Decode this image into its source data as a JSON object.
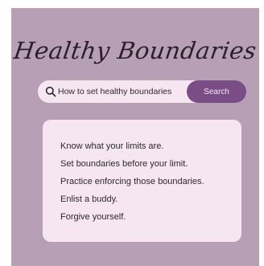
{
  "title": "Healthy Boundaries",
  "search": {
    "query": "How to set healthy boundaries",
    "button_label": "Search",
    "icon": "search-icon"
  },
  "tips": [
    "Know what your limits are.",
    "Set boundaries before your limit.",
    "Practice enforcing those boundaries.",
    "Enlist a buddy.",
    "Forgive yourself."
  ],
  "colors": {
    "background": "#b79fb5",
    "card": "#f6e6f2",
    "accent": "#7a4d86",
    "text": "#2a2a2a"
  }
}
